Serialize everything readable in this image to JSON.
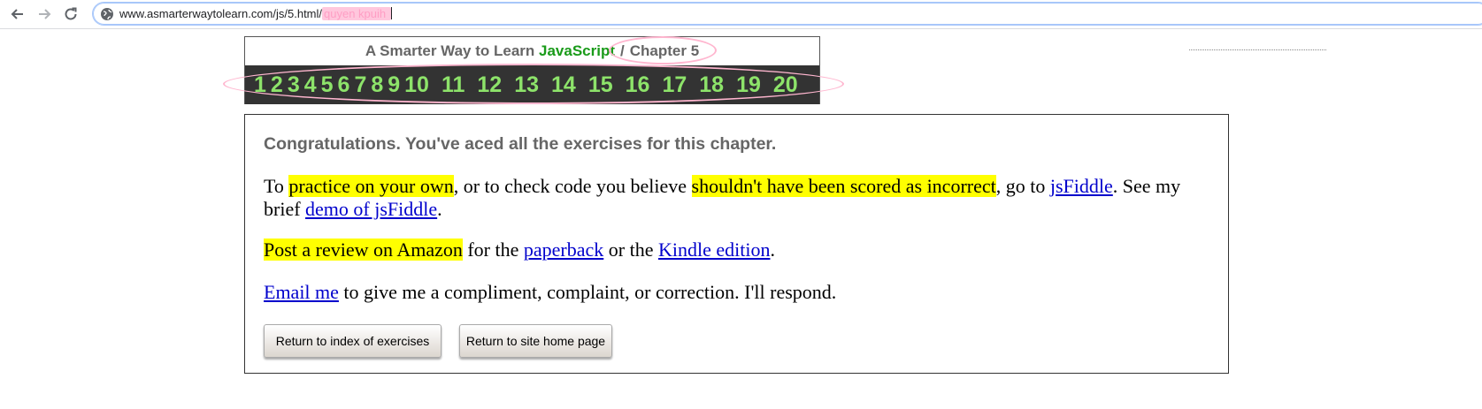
{
  "browser": {
    "url_main": "www.asmarterwaytolearn.com/js/5.html/",
    "url_typed": "quyen kpuih",
    "icons": {
      "back": "arrow-left-icon",
      "forward": "arrow-right-icon",
      "reload": "reload-icon",
      "site": "globe-icon"
    }
  },
  "header": {
    "title_prefix": "A Smarter Way to Learn",
    "title_js": "JavaScript",
    "separator": "/",
    "chapter": "Chapter 5",
    "numbers": [
      "1",
      "2",
      "3",
      "4",
      "5",
      "6",
      "7",
      "8",
      "9",
      "10",
      "11",
      "12",
      "13",
      "14",
      "15",
      "16",
      "17",
      "18",
      "19",
      "20"
    ]
  },
  "content": {
    "congrats": "Congratulations. You've aced all the exercises for this chapter.",
    "p1": {
      "t1": "To ",
      "hl1": "practice on your own",
      "t2": ", or to check code you believe ",
      "hl2": "shouldn't have been scored as incorrect",
      "t3": ", go to ",
      "link1": "jsFiddle",
      "t4": ". See my brief ",
      "link2": "demo of jsFiddle",
      "t5": "."
    },
    "p2": {
      "hl": "Post a review on Amazon",
      "t1": " for the ",
      "link1": "paperback",
      "t2": " or the ",
      "link2": "Kindle edition",
      "t3": "."
    },
    "p3": {
      "link": "Email me",
      "t1": " to give me a compliment, complaint, or correction. I'll respond."
    },
    "buttons": {
      "index": "Return to index of exercises",
      "home": "Return to site home page"
    }
  },
  "colors": {
    "accent_green": "#8de36a",
    "js_green": "#1a9b1a",
    "highlight": "#ffff00",
    "link": "#0000cc",
    "annotation_pink": "#ffb6cf",
    "strip_bg": "#333333"
  }
}
